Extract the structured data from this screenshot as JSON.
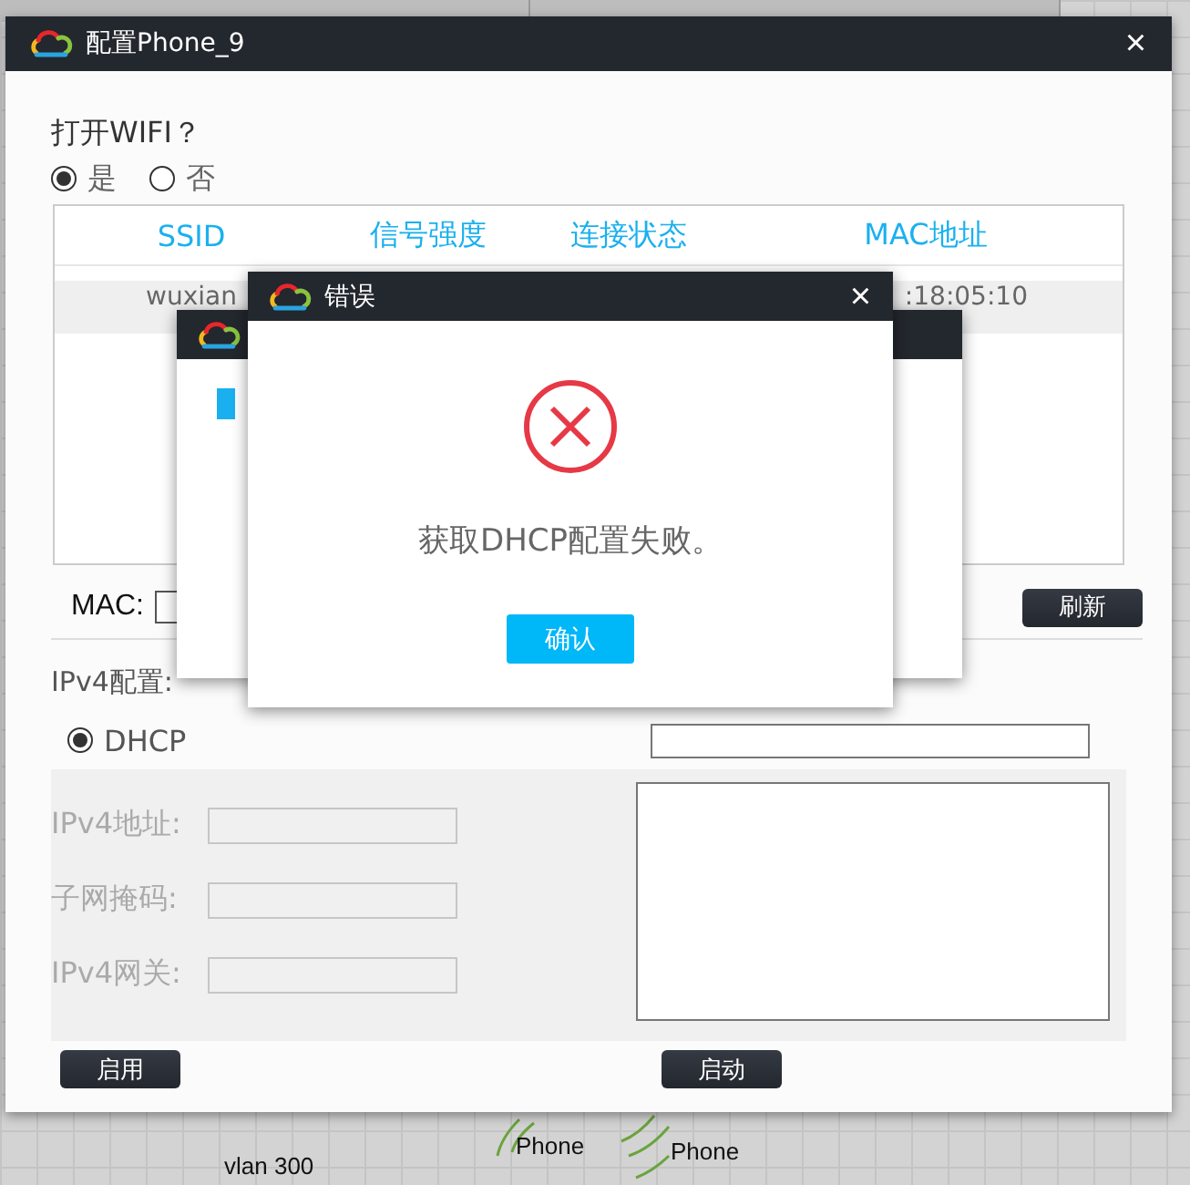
{
  "canvas_labels": [
    {
      "text": "vlan 300"
    },
    {
      "text": "Phone"
    },
    {
      "text": "Phone"
    }
  ],
  "config_dialog": {
    "title": "配置Phone_9",
    "close": "×",
    "wifi_question": "打开WIFI？",
    "wifi_options": [
      {
        "label": "是",
        "selected": true
      },
      {
        "label": "否",
        "selected": false
      }
    ],
    "wifi_table": {
      "columns": [
        "SSID",
        "信号强度",
        "连接状态",
        "MAC地址"
      ],
      "rows": [
        {
          "ssid": "wuxian",
          "mac": ":18:05:10",
          "selected": true
        }
      ]
    },
    "mac_label": "MAC:",
    "refresh_button": "刷新",
    "ipv4_label": "IPv4配置:",
    "ipv4_modes": [
      {
        "label": "DHCP",
        "selected": true
      }
    ],
    "static_fields": [
      {
        "label": "IPv4地址:",
        "disabled": true
      },
      {
        "label": "子网掩码:",
        "disabled": true
      },
      {
        "label": "IPv4网关:",
        "disabled": true
      }
    ],
    "enable_button": "启用",
    "start_button": "启动"
  },
  "error_dialog": {
    "title": "错误",
    "close": "×",
    "message": "获取DHCP配置失败。",
    "confirm_button": "确认"
  }
}
